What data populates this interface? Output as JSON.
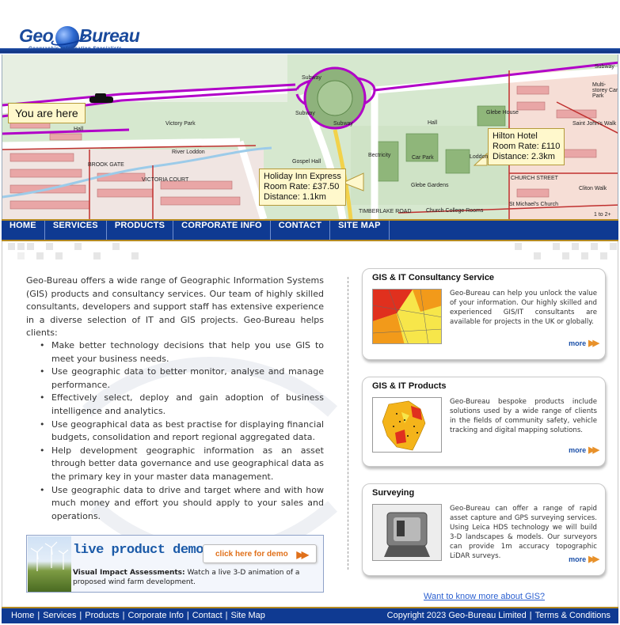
{
  "logo": {
    "geo": "Geo",
    "bureau": "Bureau",
    "tagline": "Geographic Information Specialists"
  },
  "map": {
    "you_are_here": "You are here",
    "hotels": [
      {
        "name": "Holiday Inn Express",
        "rate": "Room Rate: £37.50",
        "distance": "Distance: 1.1km"
      },
      {
        "name": "Hilton Hotel",
        "rate": "Room Rate: £110",
        "distance": "Distance: 2.3km"
      }
    ],
    "labels": [
      "Victory Park",
      "River Loddon",
      "Gospel Hall",
      "Hall",
      "Hall",
      "Bectricity",
      "Car Park",
      "Glebe Gardens",
      "Church College Rooms",
      "St Michael's Church",
      "CHURCH STREET",
      "Glebe House",
      "Saint John's Walk",
      "Multi-storey Car Park",
      "Subway",
      "Subway",
      "Subway",
      "Subway",
      "TIMBERLAKE ROAD",
      "Loddon",
      "Cliton Walk",
      "VICTORIA COURT",
      "BROOK GATE",
      "1 to 2+"
    ]
  },
  "nav": {
    "items": [
      "HOME",
      "SERVICES",
      "PRODUCTS",
      "CORPORATE INFO",
      "CONTACT",
      "SITE MAP"
    ]
  },
  "intro": {
    "paragraph": "Geo-Bureau offers a wide range of Geographic Information Systems (GIS) products and consultancy services. Our team of highly skilled consultants, developers and support staff has extensive experience in a diverse selection of IT and GIS projects.  Geo-Bureau helps clients:",
    "bullets": [
      "Make better technology decisions that help you use GIS to meet your business needs.",
      "Use geographic data to better monitor, analyse and manage performance.",
      "Effectively select, deploy and gain adoption of business intelligence and analytics.",
      "Use geographical data as best practise for displaying financial budgets, consolidation and report regional aggregated data.",
      "Help development geographic information as an asset through better data governance and use geographical data as the primary key in your master data management.",
      "Use geographic data to drive and target where and with how much money and effort you should apply to your sales and operations."
    ]
  },
  "demo": {
    "title": "live product demo",
    "button": "click here for demo",
    "desc_bold": "Visual Impact Assessments:",
    "desc_rest": " Watch a live 3-D animation of a proposed wind farm development."
  },
  "panels": [
    {
      "title": "GIS & IT Consultancy Service",
      "text": "Geo-Bureau can help you unlock the value of your information. Our highly skilled and experienced GIS/IT consultants are available for projects in the UK or globally.",
      "more": "more"
    },
    {
      "title": "GIS & IT Products",
      "text": "Geo-Bureau bespoke products include solutions used by a wide range of clients in the fields of community safety, vehicle tracking and digital mapping solutions.",
      "more": "more"
    },
    {
      "title": "Surveying",
      "text": "Geo-Bureau can offer a range of rapid asset capture and GPS surveying services. Using Leica HDS technology we will build 3-D landscapes & models. Our surveyors can provide 1m accuracy topographic LiDAR surveys.",
      "more": "more"
    }
  ],
  "gis_link": "Want to know more about GIS?",
  "footer": {
    "links": [
      "Home",
      "Services",
      "Products",
      "Corporate Info",
      "Contact",
      "Site Map"
    ],
    "copyright": "Copyright 2023 Geo-Bureau Limited",
    "terms": "Terms & Conditions"
  },
  "colors": {
    "brand_blue": "#0f3a92",
    "gold_border": "#b48a22",
    "link_blue": "#2a5fd0",
    "more_arrow": "#e8912a"
  }
}
